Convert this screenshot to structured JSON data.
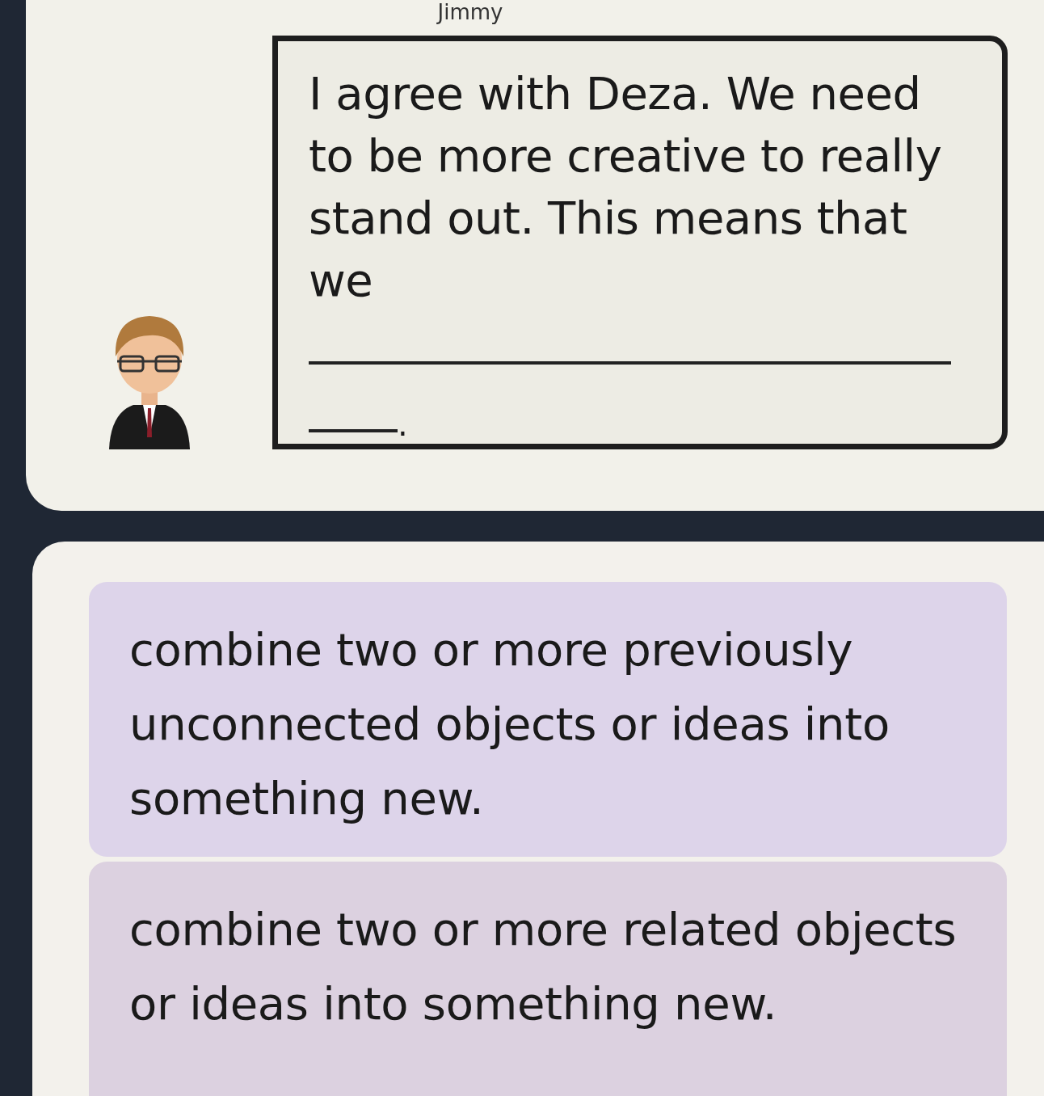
{
  "speaker": {
    "name": "Jimmy"
  },
  "bubble": {
    "text": "I agree with Deza. We need to be more creative to really stand out. This means that we",
    "end": "."
  },
  "options": [
    {
      "text": "combine two or more previously unconnected objects or ideas into something new."
    },
    {
      "text": "combine two or more related objects or ideas into something new."
    }
  ]
}
